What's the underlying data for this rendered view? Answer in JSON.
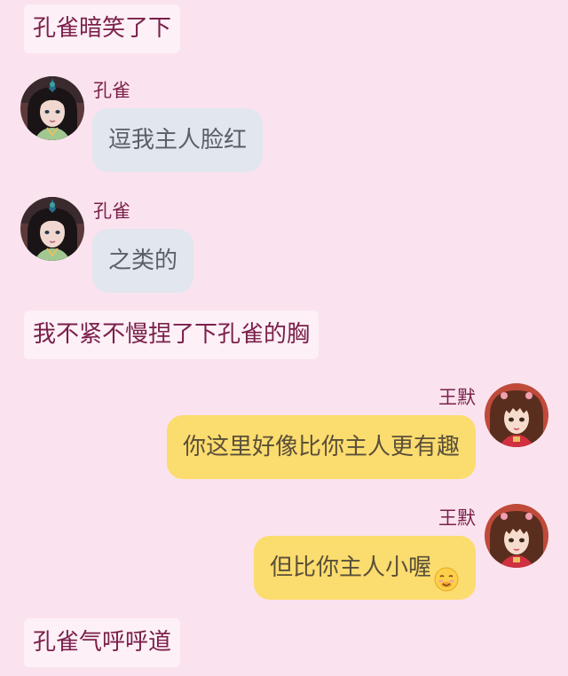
{
  "messages": [
    {
      "type": "narration",
      "text": "孔雀暗笑了下"
    },
    {
      "type": "incoming",
      "sender": "孔雀",
      "text": "逗我主人脸红"
    },
    {
      "type": "incoming",
      "sender": "孔雀",
      "text": "之类的"
    },
    {
      "type": "narration",
      "text": "我不紧不慢捏了下孔雀的胸"
    },
    {
      "type": "outgoing",
      "sender": "王默",
      "text": "你这里好像比你主人更有趣"
    },
    {
      "type": "outgoing",
      "sender": "王默",
      "text": "但比你主人小喔",
      "icon": "smirk-emoji-icon"
    },
    {
      "type": "narration",
      "text": "孔雀气呼呼道"
    }
  ],
  "colors": {
    "background": "#fae3ee",
    "narration_bg": "#fdf0f6",
    "narration_text": "#7a1f4a",
    "incoming_bubble": "#e2e6ee",
    "outgoing_bubble": "#fbdc6e",
    "sender_name": "#7a1f4a"
  },
  "avatars": {
    "kongque": "peacock-avatar-icon",
    "wangmo": "wangmo-avatar-icon"
  }
}
